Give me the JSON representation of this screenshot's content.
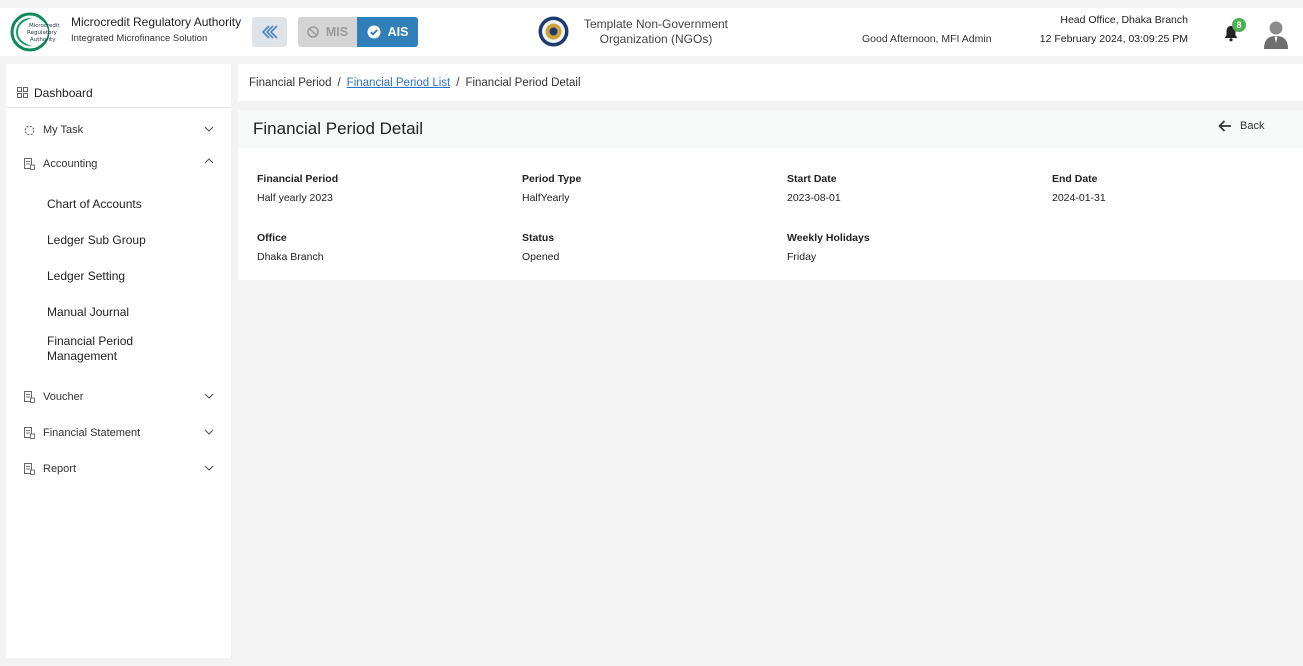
{
  "header": {
    "logo_text": [
      "Microcredit",
      "Regulatory",
      "Authority"
    ],
    "app_title": "Microcredit Regulatory Authority",
    "app_subtitle": "Integrated Microfinance Solution",
    "modes": {
      "mis": "MIS",
      "ais": "AIS",
      "active": "AIS"
    },
    "org_name_line1": "Template Non-Government",
    "org_name_line2": "Organization (NGOs)",
    "greeting": "Good Afternoon, MFI Admin",
    "office": "Head Office, Dhaka Branch",
    "datetime": "12 February 2024, 03:09:25 PM",
    "notification_count": "8",
    "accent_color": "#2f7fb8"
  },
  "sidebar": {
    "dashboard": "Dashboard",
    "items": [
      {
        "label": "My Task",
        "icon": "spinner-icon",
        "expanded": false
      },
      {
        "label": "Accounting",
        "icon": "ledger-icon",
        "expanded": true,
        "children": [
          "Chart of Accounts",
          "Ledger Sub Group",
          "Ledger Setting",
          "Manual Journal",
          "Financial Period Management"
        ]
      },
      {
        "label": "Voucher",
        "icon": "ledger-icon",
        "expanded": false
      },
      {
        "label": "Financial Statement",
        "icon": "ledger-icon",
        "expanded": false
      },
      {
        "label": "Report",
        "icon": "ledger-icon",
        "expanded": false
      }
    ]
  },
  "breadcrumb": {
    "root": "Financial Period",
    "link": "Financial Period List",
    "current": "Financial Period Detail",
    "separator": "/"
  },
  "detail": {
    "title": "Financial Period Detail",
    "back_label": "Back",
    "fields": [
      {
        "label": "Financial Period",
        "value": "Half yearly 2023"
      },
      {
        "label": "Period Type",
        "value": "HalfYearly"
      },
      {
        "label": "Start Date",
        "value": "2023-08-01"
      },
      {
        "label": "End Date",
        "value": "2024-01-31"
      },
      {
        "label": "Office",
        "value": "Dhaka Branch"
      },
      {
        "label": "Status",
        "value": "Opened"
      },
      {
        "label": "Weekly Holidays",
        "value": "Friday"
      }
    ]
  }
}
